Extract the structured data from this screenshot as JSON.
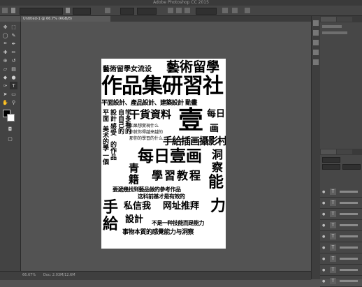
{
  "window": {
    "title": "Adobe Photoshop CC 2015"
  },
  "document_tab": {
    "label": "Untitled-1 @ 66.7% (RGB/8)"
  },
  "status": {
    "zoom": "66.67%",
    "info": "Doc: 2.03M/12.6M"
  },
  "tools": [
    "move",
    "marquee",
    "lasso",
    "quick-select",
    "crop",
    "eyedropper",
    "healing",
    "brush",
    "clone",
    "history",
    "eraser",
    "gradient",
    "blur",
    "dodge",
    "pen",
    "type",
    "path-select",
    "shape",
    "hand",
    "zoom"
  ],
  "layers": [
    {
      "type_glyph": "T"
    },
    {
      "type_glyph": "T"
    },
    {
      "type_glyph": "T"
    },
    {
      "type_glyph": "T"
    },
    {
      "type_glyph": "T"
    },
    {
      "type_glyph": "T"
    },
    {
      "type_glyph": "T"
    },
    {
      "type_glyph": "T"
    },
    {
      "type_glyph": "T"
    }
  ],
  "poster": {
    "t1": "藝術留學女流设",
    "t2": "藝術留學",
    "t3": "作品集研習社",
    "t4": "平面設計、產品設計、建築設計 動畫",
    "t5": "平面",
    "t6": "設計",
    "t7": "干貨資料",
    "t8": "壹",
    "t9": "每日",
    "t10": "画",
    "t11": "手給插画攝影村",
    "t12": "洞",
    "t13": "察",
    "t14": "每日壹画",
    "t15": "青",
    "t16": "籍",
    "t17": "學習教程",
    "t18": "能",
    "t19": "力",
    "t20": "要遞幾找到藝品做的參考作品",
    "t21": "这科前基才是有效的",
    "t22": "手",
    "t23": "給",
    "t24": "私信我",
    "t25": "网址推拜",
    "t26": "設計",
    "t27": "不是一种技能而是能力",
    "t28": "事物本質的感覺能力与洞察",
    "v1": "美术的學",
    "v2": "一個",
    "v3": "感受",
    "v4": "自自己的",
    "v5": "学多看的",
    "v6": "生個人家",
    "v7": "的作品",
    "s1": "如果想實現什么",
    "s2": "你就你得越来越的",
    "s3": "那你的學習的什么"
  }
}
